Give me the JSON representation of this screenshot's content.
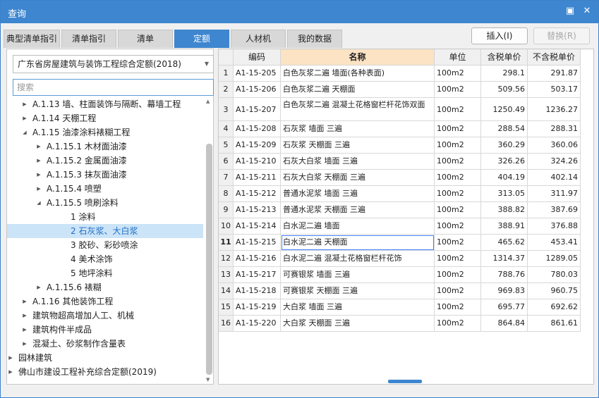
{
  "window": {
    "title": "查询",
    "restore_icon": "restore-icon",
    "close_icon": "close-icon"
  },
  "tabs": [
    {
      "label": "典型清单指引",
      "active": false
    },
    {
      "label": "清单指引",
      "active": false
    },
    {
      "label": "清单",
      "active": false
    },
    {
      "label": "定额",
      "active": true
    },
    {
      "label": "人材机",
      "active": false
    },
    {
      "label": "我的数据",
      "active": false
    }
  ],
  "buttons": {
    "insert": "插入(I)",
    "replace": "替换(R)"
  },
  "left": {
    "dataset": "广东省房屋建筑与装饰工程综合定额(2018)",
    "search_placeholder": "搜索",
    "tree": [
      {
        "label": "A.1.13 墙、柱面装饰与隔断、幕墙工程",
        "level": 1,
        "state": "collapsed"
      },
      {
        "label": "A.1.14 天棚工程",
        "level": 1,
        "state": "collapsed"
      },
      {
        "label": "A.1.15 油漆涂料裱糊工程",
        "level": 1,
        "state": "expanded"
      },
      {
        "label": "A.1.15.1 木材面油漆",
        "level": 2,
        "state": "collapsed"
      },
      {
        "label": "A.1.15.2 金属面油漆",
        "level": 2,
        "state": "collapsed"
      },
      {
        "label": "A.1.15.3 抹灰面油漆",
        "level": 2,
        "state": "collapsed"
      },
      {
        "label": "A.1.15.4 喷塑",
        "level": 2,
        "state": "collapsed"
      },
      {
        "label": "A.1.15.5 喷刷涂料",
        "level": 2,
        "state": "expanded"
      },
      {
        "label": "1 涂料",
        "level": 3,
        "state": "leaf"
      },
      {
        "label": "2 石灰浆、大白浆",
        "level": 3,
        "state": "leaf",
        "selected": true
      },
      {
        "label": "3 胶砂、彩砂喷涂",
        "level": 3,
        "state": "leaf"
      },
      {
        "label": "4 美术涂饰",
        "level": 3,
        "state": "leaf"
      },
      {
        "label": "5 地坪涂料",
        "level": 3,
        "state": "leaf"
      },
      {
        "label": "A.1.15.6 裱糊",
        "level": 2,
        "state": "collapsed"
      },
      {
        "label": "A.1.16 其他装饰工程",
        "level": 1,
        "state": "collapsed"
      },
      {
        "label": "建筑物超高增加人工、机械",
        "level": 1,
        "state": "collapsed"
      },
      {
        "label": "建筑构件半成品",
        "level": 1,
        "state": "collapsed"
      },
      {
        "label": "混凝土、砂浆制作含量表",
        "level": 1,
        "state": "collapsed"
      },
      {
        "label": "园林建筑",
        "level": 0,
        "state": "collapsed"
      },
      {
        "label": "佛山市建设工程补充综合定额(2019)",
        "level": 0,
        "state": "collapsed"
      }
    ]
  },
  "grid": {
    "columns": [
      "",
      "编码",
      "名称",
      "单位",
      "含税单价",
      "不含税单价"
    ],
    "current_row": 11,
    "rows": [
      [
        "1",
        "A1-15-205",
        "白色灰浆二遍 墙面(各种表面)",
        "100m2",
        "298.1",
        "291.87"
      ],
      [
        "2",
        "A1-15-206",
        "白色灰浆二遍 天棚面",
        "100m2",
        "509.56",
        "503.17"
      ],
      [
        "3",
        "A1-15-207",
        "白色灰浆二遍 混凝土花格窗栏杆花饰双面",
        "100m2",
        "1250.49",
        "1236.27"
      ],
      [
        "4",
        "A1-15-208",
        "石灰浆 墙面 三遍",
        "100m2",
        "288.54",
        "288.31"
      ],
      [
        "5",
        "A1-15-209",
        "石灰浆 天棚面 三遍",
        "100m2",
        "360.29",
        "360.06"
      ],
      [
        "6",
        "A1-15-210",
        "石灰大白浆 墙面 三遍",
        "100m2",
        "326.26",
        "324.26"
      ],
      [
        "7",
        "A1-15-211",
        "石灰大白浆 天棚面 三遍",
        "100m2",
        "404.19",
        "402.14"
      ],
      [
        "8",
        "A1-15-212",
        "普通水泥浆 墙面 三遍",
        "100m2",
        "313.05",
        "311.97"
      ],
      [
        "9",
        "A1-15-213",
        "普通水泥浆 天棚面 三遍",
        "100m2",
        "388.82",
        "387.69"
      ],
      [
        "10",
        "A1-15-214",
        "白水泥二遍 墙面",
        "100m2",
        "388.91",
        "376.88"
      ],
      [
        "11",
        "A1-15-215",
        "白水泥二遍 天棚面",
        "100m2",
        "465.62",
        "453.41"
      ],
      [
        "12",
        "A1-15-216",
        "白水泥二遍 混凝土花格窗栏杆花饰",
        "100m2",
        "1314.37",
        "1289.05"
      ],
      [
        "13",
        "A1-15-217",
        "可赛银浆 墙面 三遍",
        "100m2",
        "788.76",
        "780.03"
      ],
      [
        "14",
        "A1-15-218",
        "可赛银浆 天棚面 三遍",
        "100m2",
        "969.83",
        "960.75"
      ],
      [
        "15",
        "A1-15-219",
        "大白浆 墙面 三遍",
        "100m2",
        "695.77",
        "692.62"
      ],
      [
        "16",
        "A1-15-220",
        "大白浆 天棚面 三遍",
        "100m2",
        "864.84",
        "861.61"
      ]
    ]
  },
  "colors": {
    "titlebar": "#3e86cf",
    "active_tab": "#3e86cf",
    "selection": "#cce4f7",
    "header_highlight": "#fbe3c4"
  }
}
